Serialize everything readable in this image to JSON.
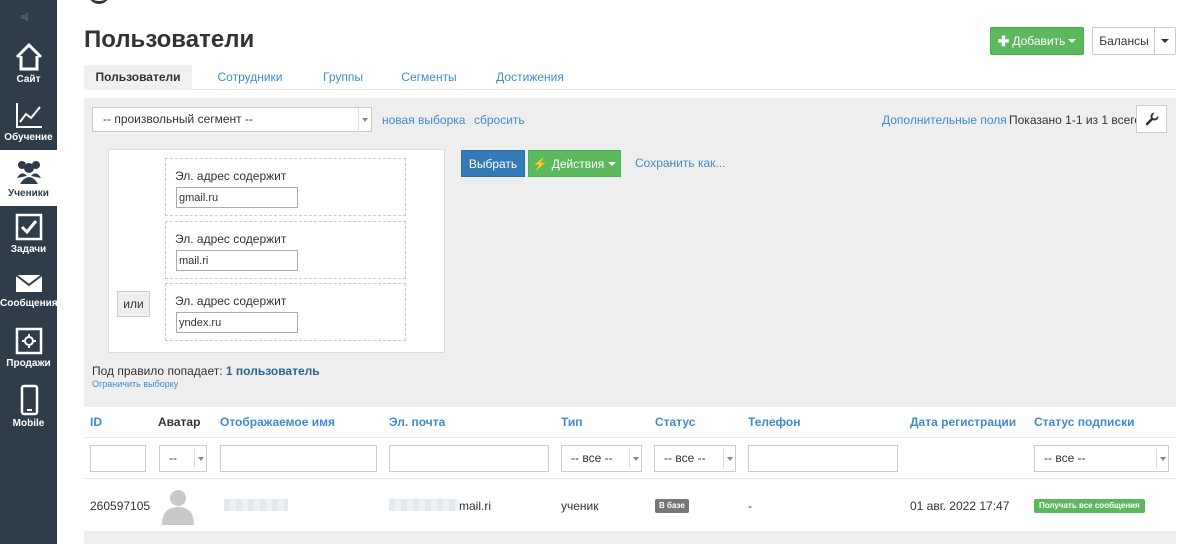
{
  "sidebar": {
    "items": [
      {
        "label": "Сайт",
        "icon": "house-icon"
      },
      {
        "label": "Обучение",
        "icon": "chart-line-icon"
      },
      {
        "label": "Ученики",
        "icon": "users-icon"
      },
      {
        "label": "Задачи",
        "icon": "checkbox-icon"
      },
      {
        "label": "Сообщения",
        "icon": "envelope-icon"
      },
      {
        "label": "Продажи",
        "icon": "safe-icon"
      },
      {
        "label": "Mobile",
        "icon": "phone-icon"
      }
    ],
    "active": "Ученики"
  },
  "header": {
    "title": "Пользователи",
    "add_label": "Добавить",
    "balances_label": "Балансы"
  },
  "tabs": [
    {
      "label": "Пользователи",
      "active": true
    },
    {
      "label": "Сотрудники"
    },
    {
      "label": "Группы"
    },
    {
      "label": "Сегменты"
    },
    {
      "label": "Достижения"
    }
  ],
  "filter": {
    "segment_value": "-- произвольный сегмент --",
    "new_selection": "новая выборка",
    "reset": "сбросить",
    "extra_fields": "Дополнительные поля",
    "shown_text": "Показано 1-1 из 1 всего.",
    "or_label": "или",
    "conditions": [
      {
        "label": "Эл. адрес содержит",
        "value": "gmail.ru"
      },
      {
        "label": "Эл. адрес содержит",
        "value": "mail.ri"
      },
      {
        "label": "Эл. адрес содержит",
        "value": "yndex.ru"
      }
    ],
    "select_button": "Выбрать",
    "actions_button": "Действия",
    "save_as": "Сохранить как...",
    "rule_count_prefix": "Под правило попадает:",
    "rule_count_value": "1 пользователь",
    "limit_link": "Ограничить выборку"
  },
  "table": {
    "headers": {
      "id": "ID",
      "avatar": "Аватар",
      "name": "Отображаемое имя",
      "email": "Эл. почта",
      "type": "Тип",
      "status": "Статус",
      "phone": "Телефон",
      "reg_date": "Дата регистрации",
      "sub_status": "Статус подписки"
    },
    "filters": {
      "avatar": "--",
      "type": "-- все --",
      "status": "-- все --",
      "sub_status": "-- все --"
    },
    "rows": [
      {
        "id": "260597105",
        "email_suffix": "mail.ri",
        "type": "ученик",
        "status": "В базе",
        "phone": "-",
        "reg_date": "01 авг. 2022 17:47",
        "sub_status": "Получать все сообщения"
      }
    ]
  },
  "colors": {
    "sidebar_bg": "#2f3c4a",
    "green": "#5cb85c",
    "blue": "#337ab7",
    "link": "#428bca"
  }
}
